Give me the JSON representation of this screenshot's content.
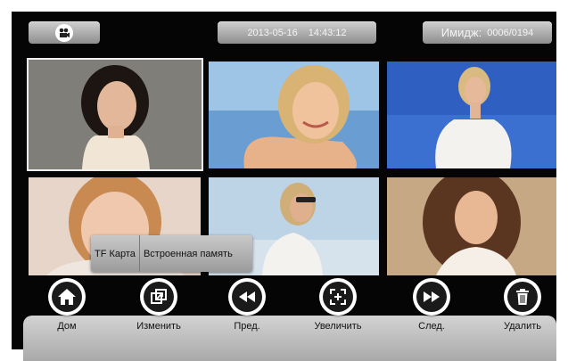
{
  "header": {
    "camera_icon": "video-camera-icon",
    "date": "2013-05-16",
    "time": "14:43:12",
    "image_label": "Имидж:",
    "image_counter": "0006/0194"
  },
  "gallery": {
    "selected_index": 0,
    "thumbnails": [
      {
        "id": 1
      },
      {
        "id": 2
      },
      {
        "id": 3
      },
      {
        "id": 4
      },
      {
        "id": 5
      },
      {
        "id": 6
      }
    ]
  },
  "storage_popup": {
    "options": [
      "TF Карта",
      "Встроенная память"
    ]
  },
  "toolbar": {
    "items": [
      {
        "label": "Дом",
        "icon": "home-icon"
      },
      {
        "label": "Изменить",
        "icon": "switch-icon"
      },
      {
        "label": "Пред.",
        "icon": "rewind-icon"
      },
      {
        "label": "Увеличить",
        "icon": "zoom-icon"
      },
      {
        "label": "След.",
        "icon": "fast-forward-icon"
      },
      {
        "label": "Удалить",
        "icon": "trash-icon"
      }
    ]
  },
  "colors": {
    "background": "#050505",
    "toolbar": "#bdbdbd",
    "button_gradient_top": "#cfcfcf",
    "selected_outline": "#f0f0f0"
  }
}
